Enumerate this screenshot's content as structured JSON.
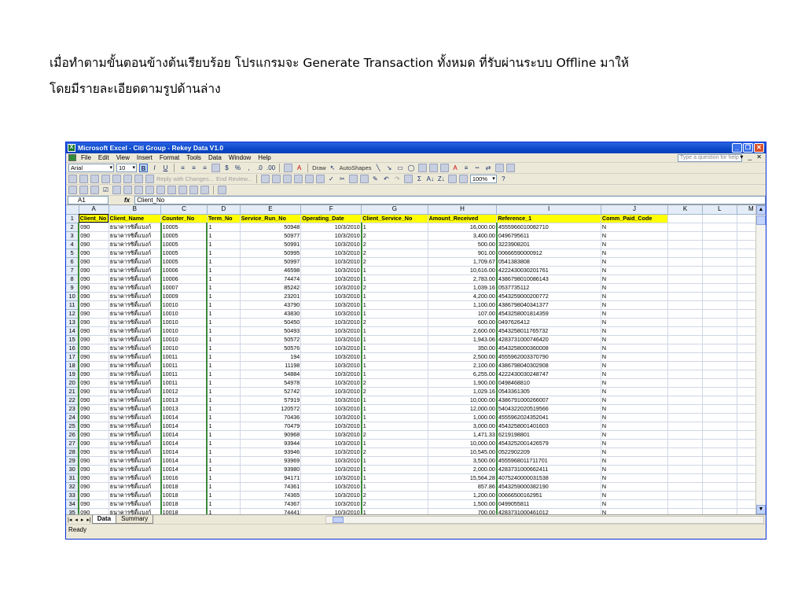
{
  "caption": {
    "line1": "เมื่อทำตามขั้นตอนข้างต้นเรียบร้อย โปรแกรมจะ Generate Transaction ทั้งหมด ที่รับผ่านระบบ Offline มาให้",
    "line2": "โดยมีรายละเอียดตามรูปด้านล่าง"
  },
  "window": {
    "title": "Microsoft Excel - Citi Group - Rekey Data V1.0",
    "help_placeholder": "Type a question for help"
  },
  "menu": [
    "File",
    "Edit",
    "View",
    "Insert",
    "Format",
    "Tools",
    "Data",
    "Window",
    "Help"
  ],
  "toolbar": {
    "font": "Arial",
    "size": "10",
    "reply_label": "Reply with Changes...",
    "end_review_label": "End Review...",
    "draw_label": "Draw",
    "autoshapes_label": "AutoShapes",
    "zoom": "100%"
  },
  "formula_bar": {
    "cell": "A1",
    "fx": "fx",
    "value": "Client_No"
  },
  "sheet": {
    "columns": [
      "A",
      "B",
      "C",
      "D",
      "E",
      "F",
      "G",
      "H",
      "I",
      "J",
      "K",
      "L",
      "M"
    ],
    "headers": [
      "Client_No",
      "Client_Name",
      "Counter_No",
      "Term_No",
      "Service_Run_No",
      "Operating_Date",
      "Client_Service_No",
      "Amount_Received",
      "Reference_1",
      "Comm_Paid_Code"
    ],
    "client_name": "ธนาคารซิตี้แบงก์",
    "rows": [
      [
        "090",
        "10005",
        "1",
        "50948",
        "10/3/2010",
        "1",
        "16,000.00",
        "4555966010082710",
        "N"
      ],
      [
        "090",
        "10005",
        "1",
        "50977",
        "10/3/2010",
        "2",
        "3,400.00",
        "0496795611",
        "N"
      ],
      [
        "090",
        "10005",
        "1",
        "50991",
        "10/3/2010",
        "2",
        "500.00",
        "3223908201",
        "N"
      ],
      [
        "090",
        "10005",
        "1",
        "50995",
        "10/3/2010",
        "2",
        "901.00",
        "00666590000912",
        "N"
      ],
      [
        "090",
        "10005",
        "1",
        "50997",
        "10/3/2010",
        "2",
        "1,709.67",
        "0541383808",
        "N"
      ],
      [
        "090",
        "10006",
        "1",
        "46598",
        "10/3/2010",
        "1",
        "10,616.00",
        "4222430030201761",
        "N"
      ],
      [
        "090",
        "10006",
        "1",
        "74474",
        "10/3/2010",
        "1",
        "2,783.00",
        "4386798010086143",
        "N"
      ],
      [
        "090",
        "10007",
        "1",
        "85242",
        "10/3/2010",
        "2",
        "1,039.16",
        "0537735112",
        "N"
      ],
      [
        "090",
        "10009",
        "1",
        "23201",
        "10/3/2010",
        "1",
        "4,200.00",
        "4543259000200772",
        "N"
      ],
      [
        "090",
        "10010",
        "1",
        "43790",
        "10/3/2010",
        "1",
        "1,100.00",
        "4386798040341377",
        "N"
      ],
      [
        "090",
        "10010",
        "1",
        "43830",
        "10/3/2010",
        "1",
        "107.00",
        "4543258001814359",
        "N"
      ],
      [
        "090",
        "10010",
        "1",
        "50450",
        "10/3/2010",
        "2",
        "600.00",
        "0497626412",
        "N"
      ],
      [
        "090",
        "10010",
        "1",
        "50493",
        "10/3/2010",
        "1",
        "2,600.00",
        "4543258011765732",
        "N"
      ],
      [
        "090",
        "10010",
        "1",
        "50572",
        "10/3/2010",
        "1",
        "1,943.06",
        "4283731000746420",
        "N"
      ],
      [
        "090",
        "10010",
        "1",
        "50576",
        "10/3/2010",
        "1",
        "350.00",
        "4543258000360008",
        "N"
      ],
      [
        "090",
        "10011",
        "1",
        "194",
        "10/3/2010",
        "1",
        "2,500.00",
        "4555962003370790",
        "N"
      ],
      [
        "090",
        "10011",
        "1",
        "11198",
        "10/3/2010",
        "1",
        "2,100.00",
        "4386798040302908",
        "N"
      ],
      [
        "090",
        "10011",
        "1",
        "54884",
        "10/3/2010",
        "1",
        "6,255.00",
        "4222430030248747",
        "N"
      ],
      [
        "090",
        "10011",
        "1",
        "54978",
        "10/3/2010",
        "2",
        "1,900.00",
        "0498468810",
        "N"
      ],
      [
        "090",
        "10012",
        "1",
        "52742",
        "10/3/2010",
        "2",
        "1,029.16",
        "0543361305",
        "N"
      ],
      [
        "090",
        "10013",
        "1",
        "57919",
        "10/3/2010",
        "1",
        "10,000.00",
        "4386791000266007",
        "N"
      ],
      [
        "090",
        "10013",
        "1",
        "120572",
        "10/3/2010",
        "1",
        "12,000.00",
        "5404322020519566",
        "N"
      ],
      [
        "090",
        "10014",
        "1",
        "70436",
        "10/3/2010",
        "1",
        "1,000.00",
        "4555962024352041",
        "N"
      ],
      [
        "090",
        "10014",
        "1",
        "70479",
        "10/3/2010",
        "1",
        "3,000.00",
        "4543258001401603",
        "N"
      ],
      [
        "090",
        "10014",
        "1",
        "90968",
        "10/3/2010",
        "2",
        "1,471.33",
        "6219198801",
        "N"
      ],
      [
        "090",
        "10014",
        "1",
        "93944",
        "10/3/2010",
        "1",
        "10,000.00",
        "4543252001426579",
        "N"
      ],
      [
        "090",
        "10014",
        "1",
        "93946",
        "10/3/2010",
        "2",
        "10,545.00",
        "0522902209",
        "N"
      ],
      [
        "090",
        "10014",
        "1",
        "93969",
        "10/3/2010",
        "1",
        "3,500.00",
        "4555968011711701",
        "N"
      ],
      [
        "090",
        "10014",
        "1",
        "93980",
        "10/3/2010",
        "1",
        "2,000.00",
        "4283731000662411",
        "N"
      ],
      [
        "090",
        "10016",
        "1",
        "94171",
        "10/3/2010",
        "1",
        "15,564.28",
        "4075240000031538",
        "N"
      ],
      [
        "090",
        "10018",
        "1",
        "74361",
        "10/3/2010",
        "1",
        "857.86",
        "4543259000382190",
        "N"
      ],
      [
        "090",
        "10018",
        "1",
        "74365",
        "10/3/2010",
        "2",
        "1,200.00",
        "00666500162951",
        "N"
      ],
      [
        "090",
        "10018",
        "1",
        "74367",
        "10/3/2010",
        "2",
        "1,500.00",
        "0499055811",
        "N"
      ],
      [
        "090",
        "10018",
        "1",
        "74441",
        "10/3/2010",
        "1",
        "700.00",
        "4283731000461012",
        "N"
      ]
    ]
  },
  "tabs": [
    "Data",
    "Summary"
  ],
  "status": "Ready"
}
